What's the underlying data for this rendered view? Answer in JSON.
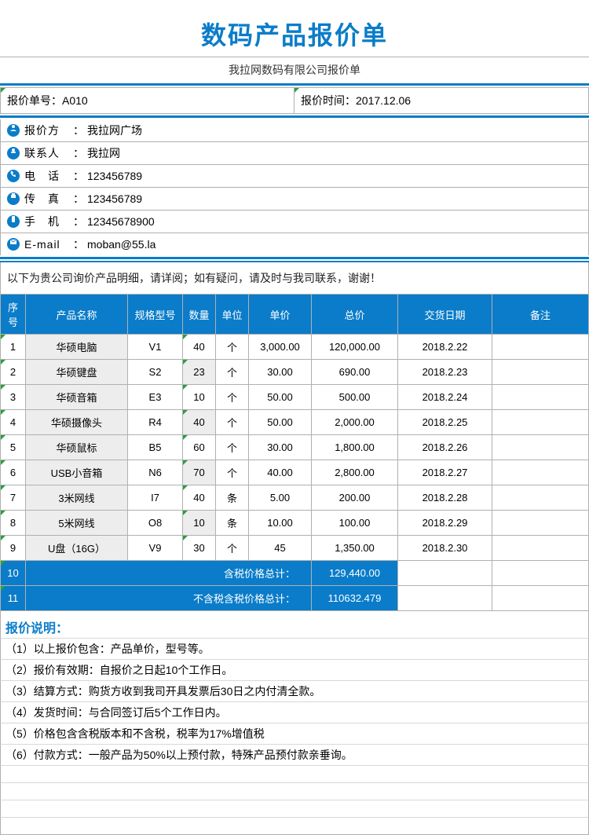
{
  "title": "数码产品报价单",
  "subtitle": "我拉网数码有限公司报价单",
  "meta": {
    "order_no_label": "报价单号：",
    "order_no_value": "A010",
    "date_label": "报价时间：",
    "date_value": "2017.12.06"
  },
  "info": {
    "party_label": "报价方",
    "party_value": "我拉网广场",
    "contact_label": "联系人",
    "contact_value": "我拉网",
    "phone_label": "电　话",
    "phone_value": "123456789",
    "fax_label": "传　真",
    "fax_value": "123456789",
    "mobile_label": "手　机",
    "mobile_value": "12345678900",
    "email_label": "E-mail ",
    "email_value": "moban@55.la"
  },
  "intro": "以下为贵公司询价产品明细，请详阅；如有疑问，请及时与我司联系，谢谢！",
  "headers": {
    "no": "序号",
    "name": "产品名称",
    "spec": "规格型号",
    "qty": "数量",
    "unit": "单位",
    "price": "单价",
    "total": "总价",
    "date": "交货日期",
    "remark": "备注"
  },
  "rows": [
    {
      "no": "1",
      "name": "华硕电脑",
      "spec": "V1",
      "qty": "40",
      "unit": "个",
      "price": "3,000.00",
      "total": "120,000.00",
      "date": "2018.2.22",
      "remark": ""
    },
    {
      "no": "2",
      "name": "华硕键盘",
      "spec": "S2",
      "qty": "23",
      "unit": "个",
      "price": "30.00",
      "total": "690.00",
      "date": "2018.2.23",
      "remark": ""
    },
    {
      "no": "3",
      "name": "华硕音箱",
      "spec": "E3",
      "qty": "10",
      "unit": "个",
      "price": "50.00",
      "total": "500.00",
      "date": "2018.2.24",
      "remark": ""
    },
    {
      "no": "4",
      "name": "华硕摄像头",
      "spec": "R4",
      "qty": "40",
      "unit": "个",
      "price": "50.00",
      "total": "2,000.00",
      "date": "2018.2.25",
      "remark": ""
    },
    {
      "no": "5",
      "name": "华硕鼠标",
      "spec": "B5",
      "qty": "60",
      "unit": "个",
      "price": "30.00",
      "total": "1,800.00",
      "date": "2018.2.26",
      "remark": ""
    },
    {
      "no": "6",
      "name": "USB小音箱",
      "spec": "N6",
      "qty": "70",
      "unit": "个",
      "price": "40.00",
      "total": "2,800.00",
      "date": "2018.2.27",
      "remark": ""
    },
    {
      "no": "7",
      "name": "3米网线",
      "spec": "I7",
      "qty": "40",
      "unit": "条",
      "price": "5.00",
      "total": "200.00",
      "date": "2018.2.28",
      "remark": ""
    },
    {
      "no": "8",
      "name": "5米网线",
      "spec": "O8",
      "qty": "10",
      "unit": "条",
      "price": "10.00",
      "total": "100.00",
      "date": "2018.2.29",
      "remark": ""
    },
    {
      "no": "9",
      "name": "U盘（16G）",
      "spec": "V9",
      "qty": "30",
      "unit": "个",
      "price": "45",
      "total": "1,350.00",
      "date": "2018.2.30",
      "remark": ""
    }
  ],
  "totals": {
    "row10_no": "10",
    "row10_label": "含税价格总计：",
    "row10_value": "129,440.00",
    "row11_no": "11",
    "row11_label": "不含税含税价格总计：",
    "row11_value": "110632.479"
  },
  "notes_title": "报价说明：",
  "notes": [
    "（1）以上报价包含：产品单价，型号等。",
    "（2）报价有效期：自报价之日起10个工作日。",
    "（3）结算方式：购货方收到我司开具发票后30日之内付清全款。",
    "（4）发货时间：与合同签订后5个工作日内。",
    "（5）价格包含含税版本和不含税，税率为17%增值税",
    "（6）付款方式：一般产品为50%以上预付款，特殊产品预付款亲垂询。"
  ],
  "colons": {
    "sep": "："
  }
}
